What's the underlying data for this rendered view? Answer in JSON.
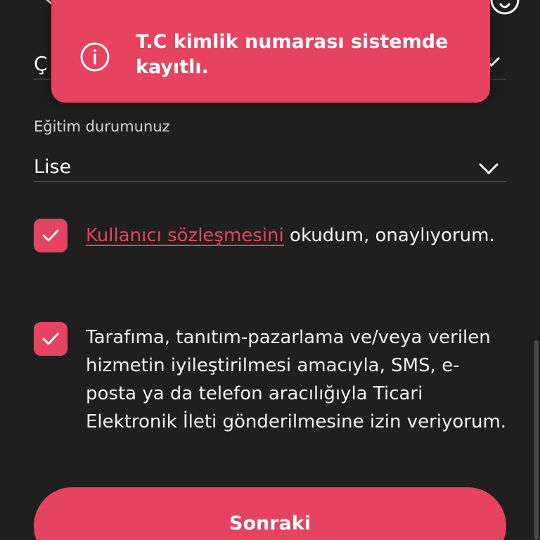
{
  "header": {
    "back_icon": "chevron-left-icon",
    "help_icon": "question-circle-icon"
  },
  "partial_field": {
    "visible_letter": "Ç",
    "icon": "chevron-down-icon"
  },
  "toast": {
    "icon": "info-circle-icon",
    "message": "T.C kimlik numarası sistemde kayıtlı."
  },
  "education": {
    "label": "Eğitim durumunuz",
    "value": "Lise",
    "icon": "chevron-down-icon"
  },
  "consents": [
    {
      "checked": true,
      "link_text": "Kullanıcı sözleşmesini",
      "text": " okudum, onaylıyorum."
    },
    {
      "checked": true,
      "text": "Tarafıma, tanıtım-pazarlama ve/veya verilen hizmetin iyileştirilmesi amacıyla, SMS, e-posta ya da telefon aracılığıyla Ticari Elektronik İleti gönderilmesine izin veriyorum."
    }
  ],
  "next_button": {
    "label": "Sonraki"
  },
  "colors": {
    "background": "#1f1f1f",
    "accent": "#e5435f",
    "divider": "#5a5a5a"
  }
}
